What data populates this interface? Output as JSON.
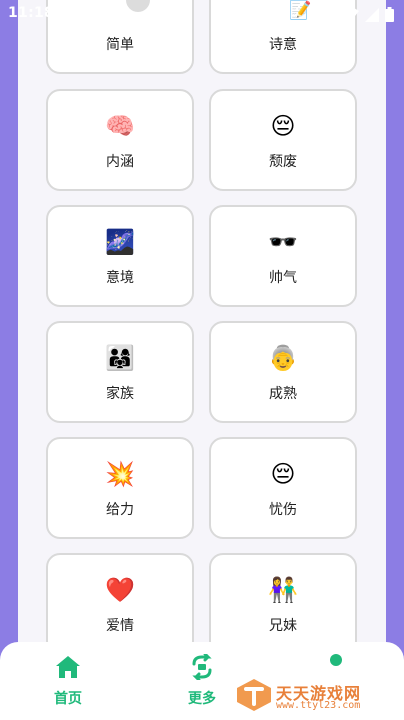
{
  "status_bar": {
    "time": "11:18",
    "notification_icon": "A",
    "icons": [
      "wifi-icon",
      "signal-icon",
      "battery-icon"
    ]
  },
  "cards": [
    {
      "emoji": "",
      "label": "简单"
    },
    {
      "emoji": "",
      "label": "诗意"
    },
    {
      "emoji": "🧠",
      "label": "内涵"
    },
    {
      "emoji": "😔",
      "label": "颓废"
    },
    {
      "emoji": "🌌",
      "label": "意境"
    },
    {
      "emoji": "🕶️",
      "label": "帅气"
    },
    {
      "emoji": "👨‍👩‍👧",
      "label": "家族"
    },
    {
      "emoji": "👵",
      "label": "成熟"
    },
    {
      "emoji": "💥",
      "label": "给力"
    },
    {
      "emoji": "😔",
      "label": "忧伤"
    },
    {
      "emoji": "❤️",
      "label": "爱情"
    },
    {
      "emoji": "👫",
      "label": "兄妹"
    }
  ],
  "bottom_nav": {
    "items": [
      {
        "label": "首页",
        "icon": "home-icon"
      },
      {
        "label": "更多",
        "icon": "swap-icon"
      },
      {
        "label": "",
        "icon": "profile-icon"
      }
    ]
  },
  "watermark": {
    "title": "天天游戏网",
    "url": "www.ttyl23.com"
  },
  "colors": {
    "background": "#8c7de4",
    "panel": "#f6f5fa",
    "accent": "#20b97b",
    "watermark": "#e8803a"
  }
}
